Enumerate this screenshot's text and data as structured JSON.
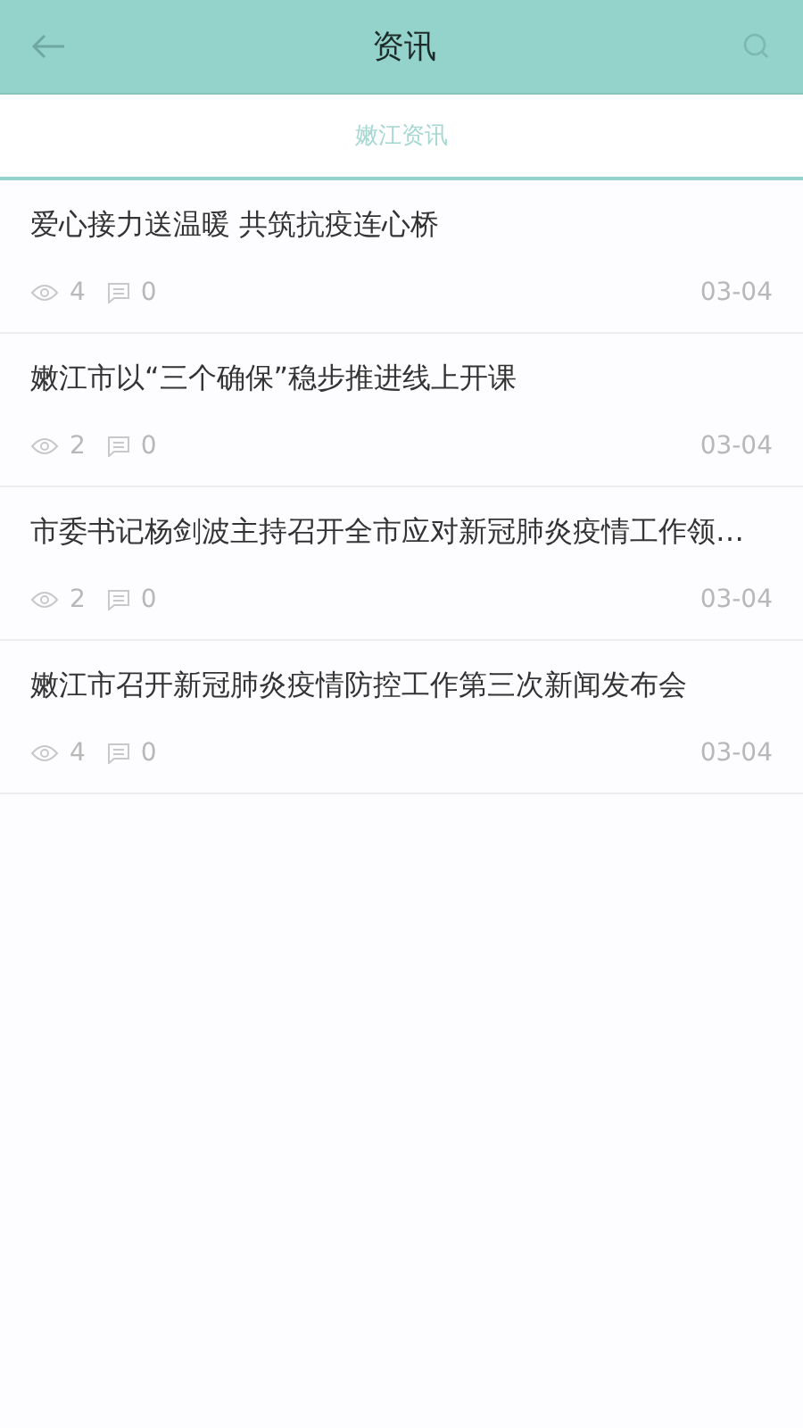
{
  "header": {
    "title": "资讯"
  },
  "tabs": [
    {
      "label": "嫩江资讯",
      "selected": true
    }
  ],
  "articles": [
    {
      "title": "爱心接力送温暖 共筑抗疫连心桥",
      "views": "4",
      "comments": "0",
      "date": "03-04"
    },
    {
      "title": "嫩江市以“三个确保”稳步推进线上开课",
      "views": "2",
      "comments": "0",
      "date": "03-04"
    },
    {
      "title": "市委书记杨剑波主持召开全市应对新冠肺炎疫情工作领…",
      "views": "2",
      "comments": "0",
      "date": "03-04"
    },
    {
      "title": "嫩江市召开新冠肺炎疫情防控工作第三次新闻发布会",
      "views": "4",
      "comments": "0",
      "date": "03-04"
    }
  ]
}
